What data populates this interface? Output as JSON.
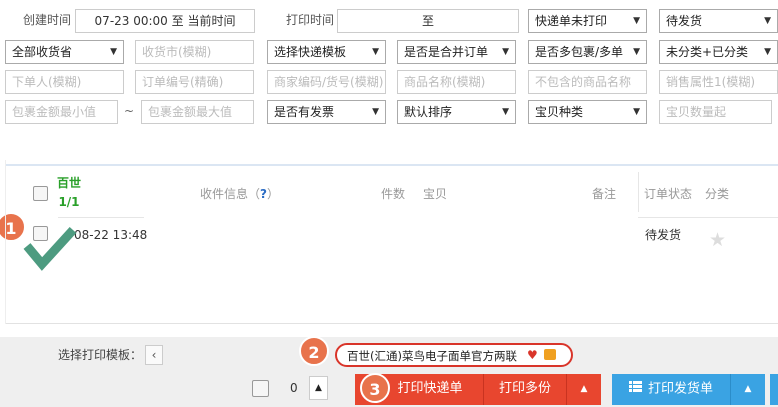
{
  "filters": {
    "create_time_label": "创建时间",
    "create_time_value": "07-23 00:00 至 当前时间",
    "print_time_label": "打印时间",
    "print_time_value": "至",
    "express_status": "快递单未打印",
    "order_status": "待发货",
    "province": "全部收货省",
    "city_placeholder": "收货市(模糊)",
    "template_select": "选择快递模板",
    "merge_select": "是否是合并订单",
    "multi_package_select": "是否多包裹/多单",
    "category_select": "未分类+已分类",
    "buyer_placeholder": "下单人(模糊)",
    "order_no_placeholder": "订单编号(精确)",
    "merchant_code_placeholder": "商家编码/货号(模糊)",
    "goods_name_placeholder": "商品名称(模糊)",
    "exclude_goods_placeholder": "不包含的商品名称",
    "sales_attr_placeholder": "销售属性1(模糊)",
    "min_amount_placeholder": "包裹金额最小值",
    "tilde": "~",
    "max_amount_placeholder": "包裹金额最大值",
    "invoice_select": "是否有发票",
    "sort_select": "默认排序",
    "item_type_select": "宝贝种类",
    "item_qty_placeholder": "宝贝数量起"
  },
  "table": {
    "carrier_label": "百世",
    "carrier_count": "1/1",
    "headers": {
      "receiver_info": "收件信息",
      "help": "?",
      "qty": "件数",
      "item": "宝贝",
      "remark": "备注",
      "order_status": "订单状态",
      "category": "分类"
    },
    "rows": [
      {
        "time": "08-22 13:48",
        "status": "待发货",
        "star": "★"
      }
    ]
  },
  "footer": {
    "select_template_label": "选择打印模板：",
    "template_chip": "百世(汇通)菜鸟电子面单官方两联",
    "count": "0",
    "print_express": "打印快递单",
    "print_multi": "打印多份",
    "print_delivery": "打印发货单"
  },
  "callouts": {
    "one": "1",
    "two": "2",
    "three": "3"
  },
  "colors": {
    "accent_red": "#e8462f",
    "accent_blue": "#3aa3e3",
    "badge_orange": "#e8734c",
    "check_green": "#4d9b80",
    "carrier_green": "#2aa02a"
  }
}
